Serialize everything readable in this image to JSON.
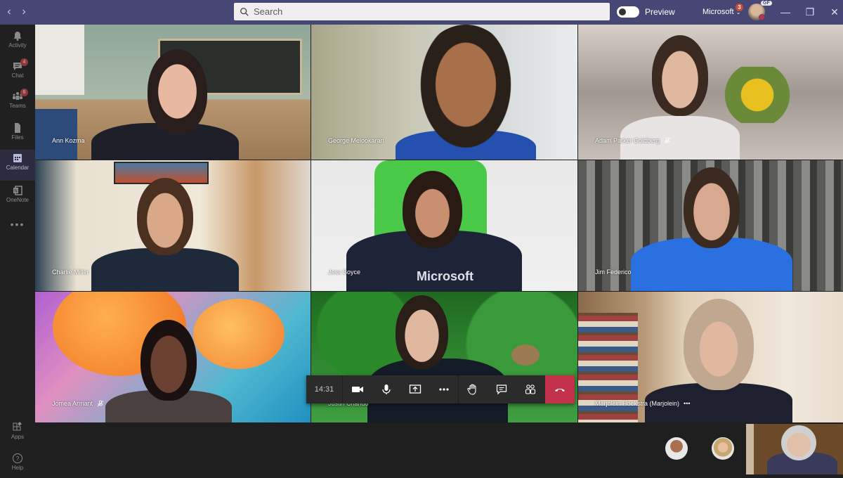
{
  "titlebar": {
    "back_icon": "chevron-left-icon",
    "forward_icon": "chevron-right-icon",
    "search_placeholder": "Search",
    "preview_label": "Preview",
    "preview_toggle_on": false,
    "org_name": "Microsoft",
    "org_badge": "3",
    "user_initials": "GF",
    "user_status": "busy",
    "minimize_icon": "minimize-icon",
    "restore_icon": "restore-icon",
    "close_icon": "close-icon"
  },
  "rail": {
    "items": [
      {
        "label": "Activity",
        "icon": "bell-icon",
        "badge": null
      },
      {
        "label": "Chat",
        "icon": "chat-icon",
        "badge": "4"
      },
      {
        "label": "Teams",
        "icon": "teams-icon",
        "badge": "6"
      },
      {
        "label": "Files",
        "icon": "file-icon",
        "badge": null
      },
      {
        "label": "Calendar",
        "icon": "calendar-icon",
        "badge": null,
        "active": true
      },
      {
        "label": "OneNote",
        "icon": "onenote-icon",
        "badge": null
      }
    ],
    "more": "•••",
    "bottom": [
      {
        "label": "Apps",
        "icon": "apps-icon"
      },
      {
        "label": "Help",
        "icon": "help-icon"
      }
    ]
  },
  "participants": [
    {
      "name": "Ann Kozma",
      "muted": false
    },
    {
      "name": "George Melookaran",
      "muted": false
    },
    {
      "name": "Adam Parker Goldberg",
      "muted": true
    },
    {
      "name": "Charlie Miller",
      "muted": false
    },
    {
      "name": "Jess Boyce",
      "muted": false,
      "shirt_text": "Microsoft"
    },
    {
      "name": "Jim Federico",
      "muted": false
    },
    {
      "name": "Jomea Armant",
      "muted": true
    },
    {
      "name": "Justin Chando",
      "muted": false
    },
    {
      "name": "Marjolein Hoekstra (Marjolein)",
      "muted": false,
      "more": "•••"
    }
  ],
  "controls": {
    "timer": "14:31",
    "buttons": [
      "video-camera",
      "microphone",
      "share-screen",
      "more-options",
      "raise-hand",
      "chat",
      "participants",
      "hang-up"
    ]
  },
  "overflow_avatars": [
    "participant-avatar-1",
    "participant-avatar-2"
  ]
}
